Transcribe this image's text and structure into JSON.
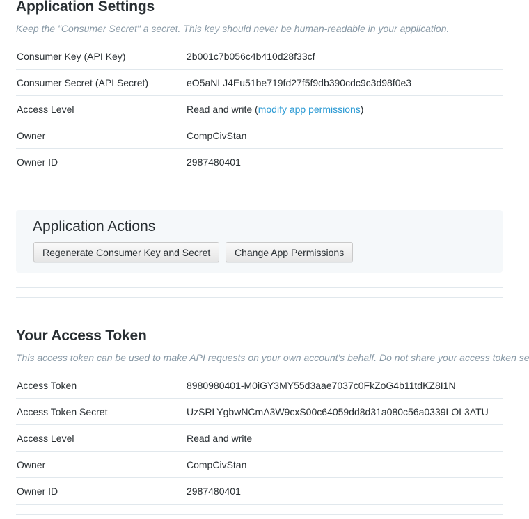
{
  "app_settings": {
    "title": "Application Settings",
    "subtitle": "Keep the \"Consumer Secret\" a secret. This key should never be human-readable in your application.",
    "rows": [
      {
        "label": "Consumer Key (API Key)",
        "value": "2b001c7b056c4b410d28f33cf"
      },
      {
        "label": "Consumer Secret (API Secret)",
        "value": "eO5aNLJ4Eu51be719fd27f5f9db390cdc9c3d98f0e3"
      },
      {
        "label": "Access Level",
        "value_prefix": "Read and write (",
        "link": "modify app permissions",
        "value_suffix": ")"
      },
      {
        "label": "Owner",
        "value": "CompCivStan"
      },
      {
        "label": "Owner ID",
        "value": "2987480401"
      }
    ]
  },
  "app_actions": {
    "title": "Application Actions",
    "regenerate_label": "Regenerate Consumer Key and Secret",
    "change_permissions_label": "Change App Permissions"
  },
  "access_token": {
    "title": "Your Access Token",
    "subtitle": "This access token can be used to make API requests on your own account's behalf. Do not share your access token se",
    "rows": [
      {
        "label": "Access Token",
        "value": "8980980401-M0iGY3MY55d3aae7037c0FkZoG4b11tdKZ8I1N"
      },
      {
        "label": "Access Token Secret",
        "value": "UzSRLYgbwNCmA3W9cxS00c64059dd8d31a080c56a0339LOL3ATU"
      },
      {
        "label": "Access Level",
        "value": "Read and write"
      },
      {
        "label": "Owner",
        "value": "CompCivStan"
      },
      {
        "label": "Owner ID",
        "value": "2987480401"
      }
    ]
  },
  "colors": {
    "link": "#2b9ad4",
    "muted": "#8899a6",
    "border": "#e1e8ed",
    "panel": "#f5f8fa"
  }
}
